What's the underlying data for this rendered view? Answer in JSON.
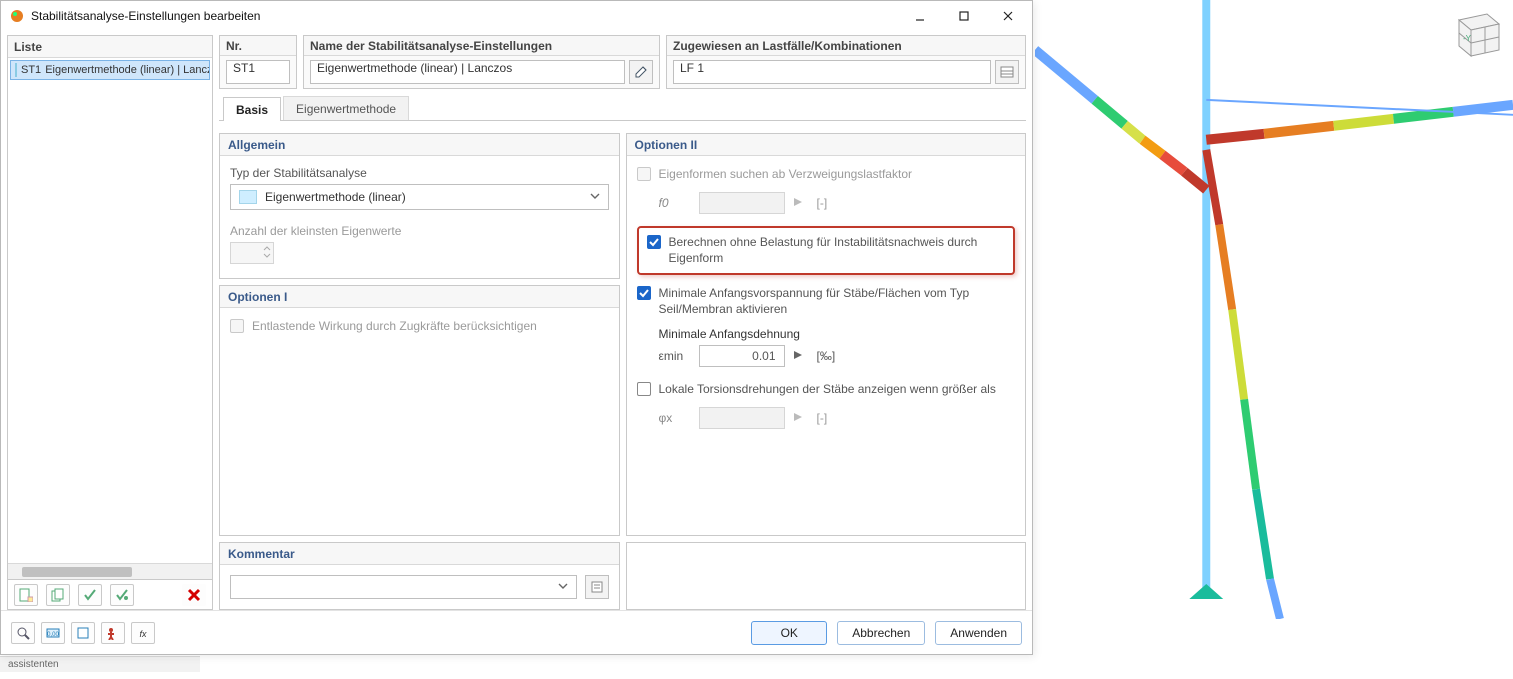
{
  "dialog": {
    "title": "Stabilitätsanalyse-Einstellungen bearbeiten",
    "winbtn_minimize": "-",
    "winbtn_maximize": "☐",
    "winbtn_close": "✕"
  },
  "list": {
    "header": "Liste",
    "items": [
      {
        "code": "ST1",
        "label": "Eigenwertmethode (linear) | Lancz"
      }
    ],
    "tool_new": "Neu",
    "tool_copy": "Kopieren",
    "tool_check1": "Ankreuzen",
    "tool_check2": "Ankreuzen 2",
    "tool_delete": "Löschen"
  },
  "top": {
    "nr_head": "Nr.",
    "nr_value": "ST1",
    "name_head": "Name der Stabilitätsanalyse-Einstellungen",
    "name_value": "Eigenwertmethode (linear) | Lanczos",
    "name_btn": "Bearbeiten",
    "assign_head": "Zugewiesen an Lastfälle/Kombinationen",
    "assign_value": "LF 1",
    "assign_btn": "Auswählen"
  },
  "tabs": {
    "basis": "Basis",
    "eigen": "Eigenwertmethode"
  },
  "allgemein": {
    "head": "Allgemein",
    "type_label": "Typ der Stabilitätsanalyse",
    "type_value": "Eigenwertmethode (linear)",
    "count_label": "Anzahl der kleinsten Eigenwerte",
    "count_value": ""
  },
  "opt1": {
    "head": "Optionen I",
    "chk1": "Entlastende Wirkung durch Zugkräfte berücksichtigen"
  },
  "opt2": {
    "head": "Optionen II",
    "chk_eigenforms": "Eigenformen suchen ab Verzweigungslastfaktor",
    "f0_sym": "f0",
    "f0_val": "",
    "f0_unit": "[-]",
    "chk_calc": "Berechnen ohne Belastung für Instabilitätsnachweis durch Eigenform",
    "chk_min_pre": "Minimale Anfangsvorspannung für Stäbe/Flächen vom Typ Seil/Membran aktivieren",
    "min_dehn_label": "Minimale Anfangsdehnung",
    "emin_sym": "εmin",
    "emin_val": "0.01",
    "emin_unit": "[‰]",
    "chk_torsion": "Lokale Torsionsdrehungen der Stäbe anzeigen wenn größer als",
    "phix_sym": "φx",
    "phix_val": "",
    "phix_unit": "[-]"
  },
  "comment": {
    "head": "Kommentar",
    "value": ""
  },
  "footer": {
    "ok": "OK",
    "cancel": "Abbrechen",
    "apply": "Anwenden"
  },
  "assistent_strip": "assistenten"
}
